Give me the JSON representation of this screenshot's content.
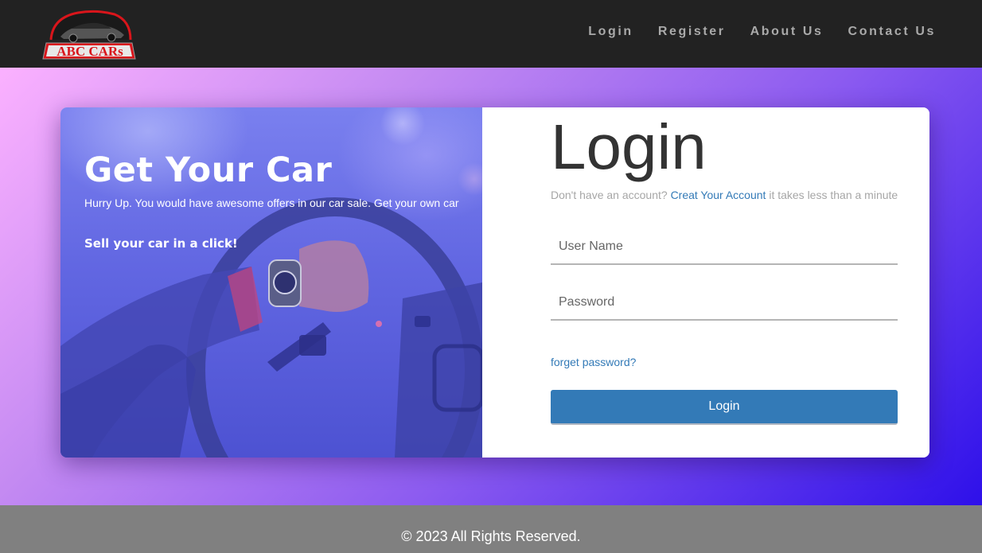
{
  "brand": {
    "logo_text": "ABC CARs",
    "colors": {
      "logo_red": "#d9151b",
      "nav_bg": "#222222",
      "link_blue": "#337ab7"
    }
  },
  "nav": {
    "links": [
      {
        "label": "Login"
      },
      {
        "label": "Register"
      },
      {
        "label": "About Us"
      },
      {
        "label": "Contact Us"
      }
    ]
  },
  "hero": {
    "title": "Get Your Car",
    "subtitle": "Hurry Up. You would have awesome offers in our car sale. Get your own car",
    "cta": "Sell your car in a click!"
  },
  "login": {
    "title": "Login",
    "signup_prefix": "Don't have an account?",
    "signup_link": "Creat Your Account",
    "signup_suffix": "it takes less than a minute",
    "username_placeholder": "User Name",
    "password_placeholder": "Password",
    "forgot_label": "forget password?",
    "submit_label": "Login"
  },
  "footer": {
    "text": "© 2023 All Rights Reserved."
  }
}
